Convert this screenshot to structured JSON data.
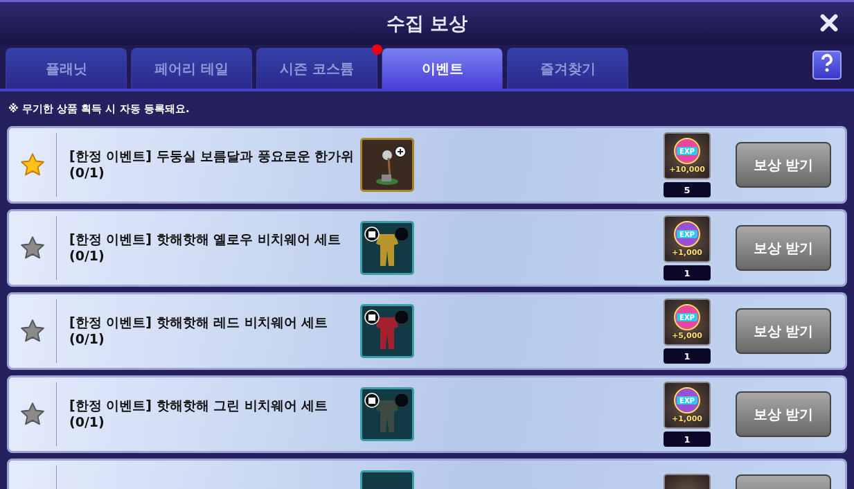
{
  "window": {
    "title": "수집 보상"
  },
  "tabs": [
    {
      "label": "플래닛",
      "selected": false,
      "badge": false
    },
    {
      "label": "페어리 테일",
      "selected": false,
      "badge": false
    },
    {
      "label": "시즌 코스튬",
      "selected": false,
      "badge": true
    },
    {
      "label": "이벤트",
      "selected": true,
      "badge": false
    },
    {
      "label": "즐겨찾기",
      "selected": false,
      "badge": false
    }
  ],
  "notice": "※ 무기한 상품 획득 시 자동 등록돼요.",
  "rows": [
    {
      "favorite": true,
      "title": "[한정 이벤트] 두둥실 보름달과 풍요로운 한가위",
      "progress": "(0/1)",
      "item": {
        "kind": "decor",
        "color": "#3f7a3a"
      },
      "reward": {
        "label": "EXP",
        "amount": "+10,000",
        "count": "5",
        "color": "#e8479e"
      },
      "button": "보상 받기"
    },
    {
      "favorite": false,
      "title": "[한정 이벤트] 핫해핫해 옐로우 비치웨어 세트",
      "progress": "(0/1)",
      "item": {
        "kind": "outfit",
        "color": "#b8962a"
      },
      "reward": {
        "label": "EXP",
        "amount": "+1,000",
        "count": "1",
        "color": "#9a4fd6"
      },
      "button": "보상 받기"
    },
    {
      "favorite": false,
      "title": "[한정 이벤트] 핫해핫해 레드 비치웨어 세트",
      "progress": "(0/1)",
      "item": {
        "kind": "outfit",
        "color": "#a3202e"
      },
      "reward": {
        "label": "EXP",
        "amount": "+5,000",
        "count": "1",
        "color": "#e8479e"
      },
      "button": "보상 받기"
    },
    {
      "favorite": false,
      "title": "[한정 이벤트] 핫해핫해 그린 비치웨어 세트",
      "progress": "(0/1)",
      "item": {
        "kind": "outfit",
        "color": "#3d4a44"
      },
      "reward": {
        "label": "EXP",
        "amount": "+1,000",
        "count": "1",
        "color": "#9a4fd6"
      },
      "button": "보상 받기"
    }
  ],
  "more_rows_below": true
}
